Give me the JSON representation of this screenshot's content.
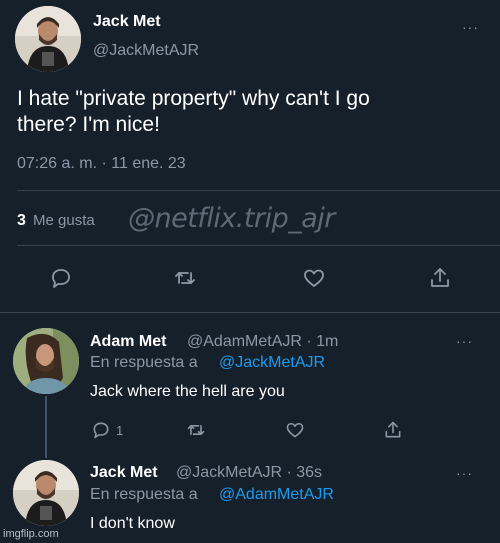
{
  "main_tweet": {
    "display_name": "Jack Met",
    "handle": "@JackMetAJR",
    "text_line1": "I hate \"private property\" why can't I go",
    "text_line2": "there? I'm nice!",
    "timestamp": "07:26 a. m. · 11 ene. 23",
    "likes_count": "3",
    "likes_label": "Me gusta",
    "more_label": "···"
  },
  "watermark": "@netflix.trip_ajr",
  "action_bar": {
    "icons": [
      "reply-icon",
      "retweet-icon",
      "like-icon",
      "share-icon"
    ]
  },
  "replies": [
    {
      "display_name": "Adam Met",
      "handle_time": "@AdamMetAJR · 1m",
      "replying_prefix": "En respuesta a",
      "replying_to": "@JackMetAJR",
      "text": "Jack where the hell are you",
      "reply_count": "1",
      "more_label": "···"
    },
    {
      "display_name": "Jack Met",
      "handle_time": "@JackMetAJR · 36s",
      "replying_prefix": "En respuesta a",
      "replying_to": "@AdamMetAJR",
      "text": "I don't know",
      "more_label": "···"
    }
  ],
  "footer_watermark": "imgflip.com",
  "colors": {
    "background": "#15202b",
    "muted": "#8b98a5",
    "link": "#1d9bf0",
    "divider": "#38444d"
  }
}
